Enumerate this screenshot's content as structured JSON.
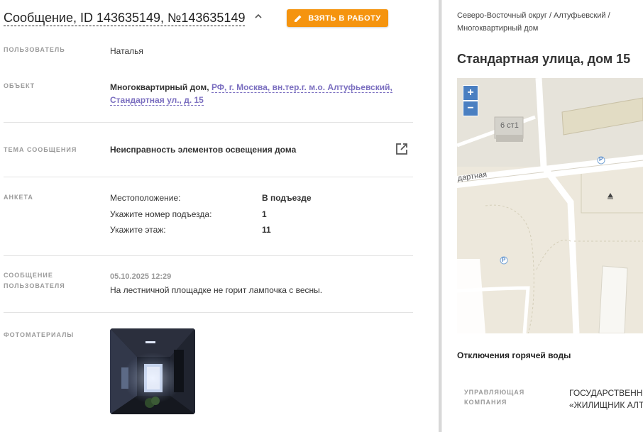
{
  "header": {
    "title": "Сообщение, ID 143635149, №143635149",
    "take_button": "ВЗЯТЬ В РАБОТУ"
  },
  "user": {
    "label": "ПОЛЬЗОВАТЕЛЬ",
    "value": "Наталья"
  },
  "object": {
    "label": "ОБЪЕКТ",
    "type": "Многоквартирный дом,",
    "address_line1": "РФ, г. Москва, вн.тер.г. м.о. Алтуфьевский,",
    "address_line2": "Стандартная ул., д. 15"
  },
  "topic": {
    "label": "ТЕМА СООБЩЕНИЯ",
    "value": "Неисправность элементов освещения дома"
  },
  "survey": {
    "label": "АНКЕТА",
    "rows": [
      {
        "question": "Местоположение:",
        "answer": "В подъезде"
      },
      {
        "question": "Укажите номер подъезда:",
        "answer": "1"
      },
      {
        "question": "Укажите этаж:",
        "answer": "11"
      }
    ]
  },
  "message": {
    "label_line1": "СООБЩЕНИЕ",
    "label_line2": "ПОЛЬЗОВАТЕЛЯ",
    "date": "05.10.2025 12:29",
    "text": "На лестничной площадке не горит лампочка с весны."
  },
  "photos": {
    "label": "ФОТОМАТЕРИАЛЫ"
  },
  "right": {
    "breadcrumb_line1": "Северо-Восточный округ / Алтуфьевский /",
    "breadcrumb_line2": "Многоквартирный дом",
    "address": "Стандартная улица, дом 15",
    "map": {
      "zoom_in": "+",
      "zoom_out": "−",
      "building_label": "6 ст1",
      "street_label": "дартная",
      "parking_1": "P",
      "parking_2": "P"
    },
    "hot_water": "Отключения горячей воды",
    "management_label_line1": "УПРАВЛЯЮЩАЯ",
    "management_label_line2": "КОМПАНИЯ",
    "management_value_line1": "ГОСУДАРСТВЕННОЕ",
    "management_value_line2": "«ЖИЛИЩНИК АЛТ"
  },
  "colors": {
    "accent": "#f5940f",
    "link": "#7b6fc0",
    "map_zoom": "#4a7fc1"
  }
}
